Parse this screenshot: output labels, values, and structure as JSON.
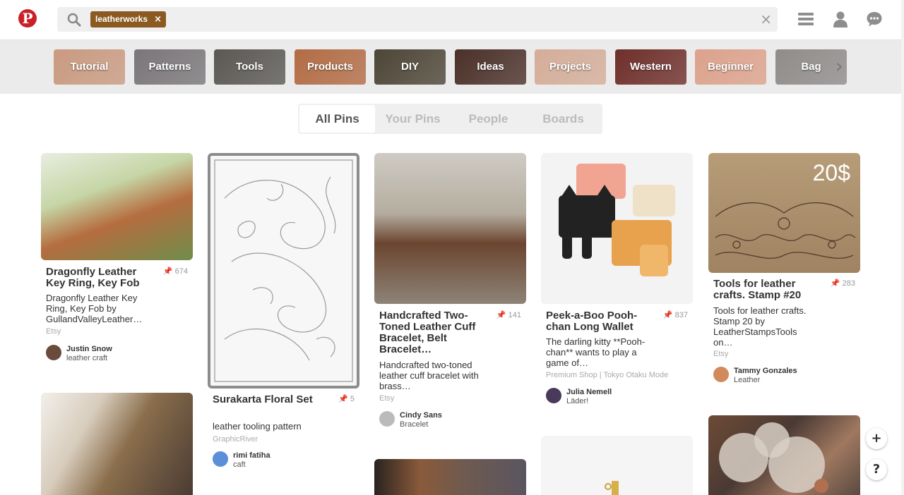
{
  "search": {
    "tag": "leatherworks",
    "tag_remove": "×",
    "clear": "×"
  },
  "guides": {
    "items": [
      {
        "label": "Tutorial",
        "color": "#c99a80"
      },
      {
        "label": "Patterns",
        "color": "#7a7679"
      },
      {
        "label": "Tools",
        "color": "#5b5854"
      },
      {
        "label": "Products",
        "color": "#b26c45"
      },
      {
        "label": "DIY",
        "color": "#4d4536"
      },
      {
        "label": "Ideas",
        "color": "#4a3028"
      },
      {
        "label": "Projects",
        "color": "#d4ad99"
      },
      {
        "label": "Western",
        "color": "#6e2f2a"
      },
      {
        "label": "Beginner",
        "color": "#dca28c"
      },
      {
        "label": "Bag",
        "color": "#8f8c8a"
      }
    ],
    "next": "›"
  },
  "tabs": [
    "All Pins",
    "Your Pins",
    "People",
    "Boards"
  ],
  "pins": [
    {
      "title": "Dragonfly Leather Key Ring, Key Fob",
      "count": "674",
      "desc": "Dragonfly Leather Key Ring, Key Fob by GullandValleyLeather…",
      "source": "Etsy",
      "user": "Justin Snow",
      "board": "leather craft",
      "img_color": "#b56d3f",
      "avatar_color": "#6a4a3a"
    },
    {
      "title": "Surakarta Floral Set",
      "count": "5",
      "desc": "leather tooling pattern",
      "source": "GraphicRiver",
      "user": "rimi fatiha",
      "board": "caft",
      "img_color": "#f4f4f4",
      "avatar_color": "#5b8fd8"
    },
    {
      "title": "Handcrafted Two-Toned Leather Cuff Bracelet, Belt Bracelet…",
      "count": "141",
      "desc": "Handcrafted two-toned leather cuff bracelet with brass…",
      "source": "Etsy",
      "user": "Cindy Sans",
      "board": "Bracelet",
      "img_color": "#6b4530",
      "avatar_color": "#bbbbbb"
    },
    {
      "title": "Peek-a-Boo Pooh-chan Long Wallet",
      "count": "837",
      "desc": "The darling kitty **Pooh-chan** wants to play a game of…",
      "source": "Premium Shop | Tokyo Otaku Mode",
      "user": "Julia Nemell",
      "board": "Läder!",
      "img_color": "#f3f3f3",
      "avatar_color": "#4a3a5a"
    },
    {
      "title": "Tools for leather crafts. Stamp #20",
      "count": "283",
      "desc": "Tools for leather crafts. Stamp 20 by LeatherStampsTools on…",
      "source": "Etsy",
      "user": "Tammy Gonzales",
      "board": "Leather",
      "img_color": "#a4865f",
      "img_text": "20$",
      "avatar_color": "#d38a5a"
    }
  ],
  "fab": {
    "add": "+",
    "help": "?"
  }
}
